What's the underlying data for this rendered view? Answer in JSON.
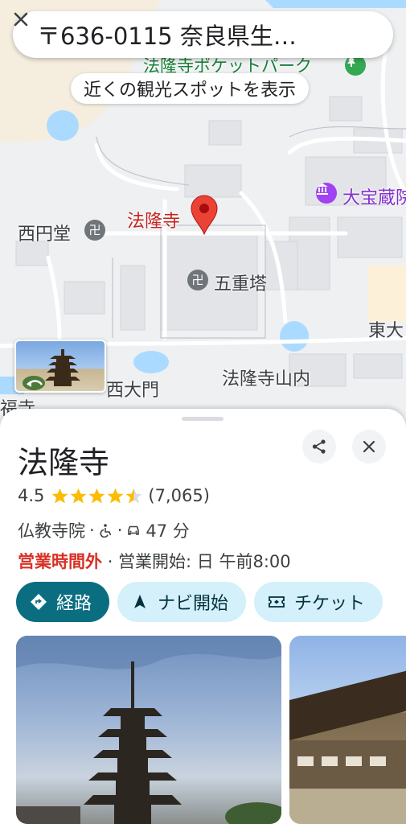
{
  "search": {
    "text": "〒636-0115 奈良県生…",
    "close_icon": "close-icon"
  },
  "map": {
    "nearby_chip": "近くの観光スポットを表示",
    "labels": {
      "pocket_park": "法隆寺ポケットパーク",
      "daihozo": "大宝蔵院",
      "horyuji": "法隆寺",
      "saiendo": "西円堂",
      "gojunoto": "五重塔",
      "todai": "東大",
      "nishi_daimon": "西大門",
      "sannai": "法隆寺山内",
      "fuku": "福寺"
    },
    "colors": {
      "pin": "#ea4335",
      "water": "#aadaff",
      "building": "#dadce0",
      "road": "#ffffff"
    }
  },
  "place": {
    "name": "法隆寺",
    "rating": "4.5",
    "rating_value": 4.5,
    "review_count": "(7,065)",
    "category": "仏教寺院",
    "drive_time": "47 分",
    "status_closed": "営業時間外",
    "opens": "· 営業開始: 日 午前8:00",
    "share_icon": "share-icon",
    "close_icon": "close-icon"
  },
  "actions": {
    "directions": "経路",
    "navigate": "ナビ開始",
    "tickets": "チケット"
  },
  "colors": {
    "accent": "#0a6e80",
    "chip": "#d3f0fb",
    "star": "#fbbc04",
    "closed": "#d93025"
  }
}
